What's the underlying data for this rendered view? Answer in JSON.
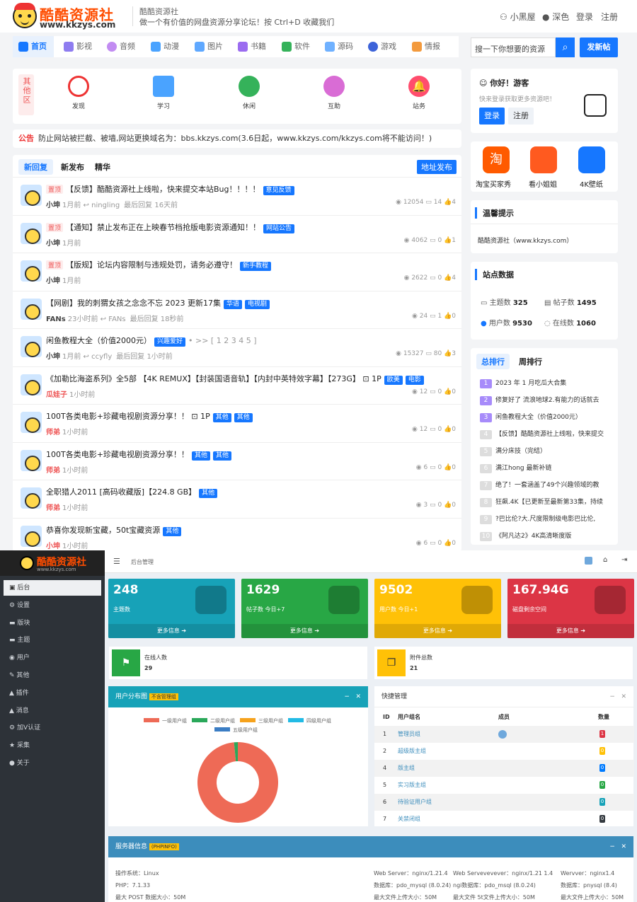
{
  "site": {
    "name": "酷酷资源社",
    "domain": "www.kkzys.com",
    "tagline_title": "酷酷资源社",
    "tagline": "做一个有价值的网盘资源分享论坛！按 Ctrl+D 收藏我们",
    "links": [
      "小黑屋",
      "深色",
      "登录",
      "注册"
    ]
  },
  "nav": [
    "首页",
    "影视",
    "音频",
    "动漫",
    "图片",
    "书籍",
    "软件",
    "源码",
    "游戏",
    "情报"
  ],
  "search": {
    "placeholder": "搜一下你想要的资源",
    "post": "发新帖"
  },
  "categories": {
    "label": "其他区",
    "items": [
      "发现",
      "学习",
      "休闲",
      "互助",
      "站务"
    ]
  },
  "notice": {
    "label": "公告",
    "text": "防止网站被拦截、被墙,网站更换域名为：bbs.kkzys.com(3.6日起，www.kkzys.com/kkzys.com将不能访问！)"
  },
  "feed": {
    "tabs": [
      "新回复",
      "新发布",
      "精华"
    ],
    "address_btn": "地址发布",
    "rows": [
      {
        "pin": "置顶",
        "title": "【反馈】酷酷资源社上线啦，快来提交本站Bug！！！！",
        "tags": [
          "意见反馈"
        ],
        "author": "小坤",
        "time": "1月前",
        "reply": "ningling",
        "last": "最后回复 16天前",
        "views": "12054",
        "replies": "14",
        "likes": "4"
      },
      {
        "pin": "置顶",
        "title": "【通知】禁止发布正在上映春节档抢版电影资源通知！！",
        "tags": [
          "网站公告"
        ],
        "author": "小坤",
        "time": "1月前",
        "reply": "",
        "last": "",
        "views": "4062",
        "replies": "0",
        "likes": "1"
      },
      {
        "pin": "置顶",
        "title": "【版规】论坛内容限制与违规处罚，请务必遵守！",
        "tags": [
          "新手教程"
        ],
        "author": "小坤",
        "time": "1月前",
        "reply": "",
        "last": "",
        "views": "2622",
        "replies": "0",
        "likes": "4"
      },
      {
        "pin": "",
        "title": "【网剧】我的刺猬女孩之念念不忘 2023 更新17集",
        "tags": [
          "华语",
          "电视剧"
        ],
        "author": "FANs",
        "time": "23小时前",
        "reply": "FANs",
        "last": "最后回复 18秒前",
        "views": "24",
        "replies": "1",
        "likes": "0"
      },
      {
        "pin": "",
        "title": "闲鱼教程大全（价值2000元）",
        "tags": [
          "兴趣爱好"
        ],
        "extra": "• >> [ 1 2 3 4 5 ]",
        "author": "小坤",
        "time": "1月前",
        "reply": "ccyfly",
        "last": "最后回复 1小时前",
        "views": "15327",
        "replies": "80",
        "likes": "3"
      },
      {
        "pin": "",
        "title": "《加勒比海盗系列》全5部 【4K REMUX】【封装国语音轨】【内封中英特效字幕】【273G】 ⊡ 1P",
        "tags": [
          "欧美",
          "电影"
        ],
        "author": "瓜娃子",
        "time": "1小时前",
        "reply": "",
        "last": "",
        "views": "12",
        "replies": "0",
        "likes": "0"
      },
      {
        "pin": "",
        "title": "100T各类电影+珍藏电视剧资源分享！！ ⊡ 1P",
        "tags": [
          "其他",
          "其他"
        ],
        "author": "师弟",
        "time": "1小时前",
        "reply": "",
        "last": "",
        "views": "12",
        "replies": "0",
        "likes": "0"
      },
      {
        "pin": "",
        "title": "100T各类电影+珍藏电视剧资源分享！！",
        "tags": [
          "其他",
          "其他"
        ],
        "author": "师弟",
        "time": "1小时前",
        "reply": "",
        "last": "",
        "views": "6",
        "replies": "0",
        "likes": "0"
      },
      {
        "pin": "",
        "title": "全职猎人2011 [高码收藏版]【224.8 GB】",
        "tags": [
          "其他"
        ],
        "author": "师弟",
        "time": "1小时前",
        "reply": "",
        "last": "",
        "views": "3",
        "replies": "0",
        "likes": "0"
      },
      {
        "pin": "",
        "title": "恭喜你发现新宝藏，50t宝藏资源",
        "tags": [
          "其他"
        ],
        "author": "小坤",
        "time": "1小时前",
        "reply": "",
        "last": "",
        "views": "6",
        "replies": "0",
        "likes": "0"
      }
    ]
  },
  "welcome": {
    "title": "你好！游客",
    "sub": "快来登录获取更多资源吧！",
    "login": "登录",
    "register": "注册"
  },
  "apps": [
    "淘宝买家秀",
    "看小姐姐",
    "4K壁纸"
  ],
  "tips": {
    "title": "温馨提示",
    "text": "酷酷资源社（www.kkzys.com）"
  },
  "stats": {
    "title": "站点数据",
    "topics_l": "主题数",
    "topics": "325",
    "posts_l": "帖子数",
    "posts": "1495",
    "users_l": "用户数",
    "users": "9530",
    "online_l": "在线数",
    "online": "1060"
  },
  "rank": {
    "tabs": [
      "总排行",
      "周排行"
    ],
    "items": [
      "2023 年 1 月吃瓜大合集",
      "修复好了 流浪地球2.有能力的话就去",
      "闲鱼教程大全（价值2000元）",
      "【反馈】酷酷资源社上线啦，快来提交",
      "满分床技（完结）",
      "满江hong 最新补链",
      "绝了！一套涵盖了49个兴趣领域的教",
      "狂飙.4K【已更新至最新第33集，持续",
      "?巴比伦?大.尺度限制级电影巴比伦,",
      "《阿凡达2》4K高清晰度版"
    ]
  },
  "admin": {
    "breadcrumb": "后台管理",
    "menu": [
      "后台",
      "设置",
      "版块",
      "主题",
      "用户",
      "其他",
      "插件",
      "消息",
      "加V认证",
      "采集",
      "关于"
    ],
    "cards": [
      {
        "value": "248",
        "label": "主题数",
        "more": "更多信息",
        "color": "#17a2b8"
      },
      {
        "value": "1629",
        "label": "帖子数 今日+7",
        "more": "更多信息",
        "color": "#28a745"
      },
      {
        "value": "9502",
        "label": "用户数 今日+1",
        "more": "更多信息",
        "color": "#ffc107"
      },
      {
        "value": "167.94G",
        "label": "磁盘剩余空间",
        "more": "更多信息",
        "color": "#dc3545"
      }
    ],
    "online": {
      "label": "在线人数",
      "value": "29"
    },
    "attach": {
      "label": "附件总数",
      "value": "21"
    },
    "dist": {
      "title": "用户分布图",
      "badge": "不含管理组"
    },
    "quick": {
      "title": "快捷管理",
      "headers": [
        "ID",
        "用户组名",
        "成员",
        "数量"
      ],
      "rows": [
        {
          "id": "1",
          "name": "管理员组",
          "count": "1",
          "color": "#dc3545"
        },
        {
          "id": "2",
          "name": "超级版主组",
          "count": "0",
          "color": "#ffc107"
        },
        {
          "id": "4",
          "name": "版主组",
          "count": "0",
          "color": "#007bff"
        },
        {
          "id": "5",
          "name": "实习版主组",
          "count": "0",
          "color": "#28a745"
        },
        {
          "id": "6",
          "name": "待验证用户组",
          "count": "0",
          "color": "#17a2b8"
        },
        {
          "id": "7",
          "name": "关禁闭组",
          "count": "0",
          "color": "#343a40"
        }
      ]
    },
    "server": {
      "title": "服务器信息",
      "badge": "(PHPINFO)",
      "lines": [
        "操作系统：Linux",
        "PHP：7.1.33",
        "最大 POST 数据大小：50M"
      ],
      "lines2": [
        "Web Server：nginx/1.21.4",
        "数据库：pdo_mysql (8.0.24)",
        "最大文件上传大小：50M"
      ],
      "lines3": [
        "Web Servevevever：nginx/1.21 1.4",
        "ngi数据库：pdo_msql (8.0.24)",
        "最大文件 5t文件上传大小：50M"
      ],
      "lines4": [
        "Wervver：nginx1.4",
        "数据库：pnysql (8.4)",
        "最大文件上传大小：50M"
      ]
    }
  },
  "chart_data": {
    "type": "pie",
    "title": "用户分布图",
    "legend": [
      "一级用户组",
      "二级用户组",
      "三级用户组",
      "四级用户组",
      "五级用户组"
    ],
    "values": [
      98.5,
      1.5,
      0,
      0,
      0
    ],
    "colors": [
      "#ee6a56",
      "#2aa85a",
      "#f6a21c",
      "#22bbe5",
      "#3b7dc4"
    ]
  }
}
